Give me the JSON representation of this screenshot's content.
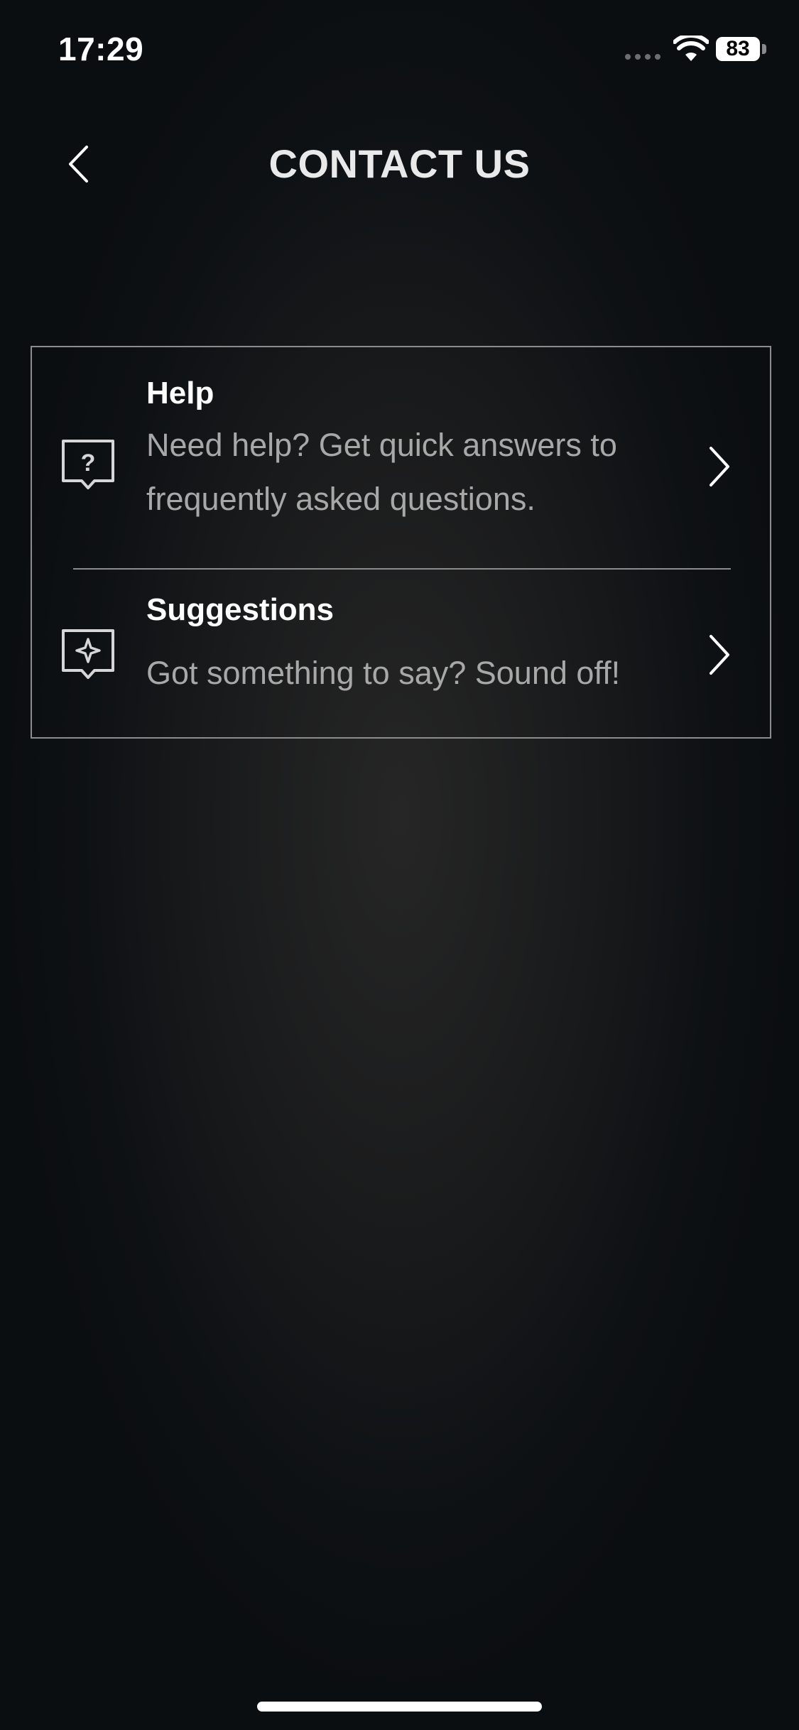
{
  "status_bar": {
    "time": "17:29",
    "battery": "83"
  },
  "header": {
    "title": "CONTACT US"
  },
  "menu": {
    "items": [
      {
        "title": "Help",
        "description": "Need help? Get quick answers to frequently asked questions.",
        "icon": "help-chat-icon"
      },
      {
        "title": "Suggestions",
        "description": "Got something to say? Sound off!",
        "icon": "suggestion-chat-icon"
      }
    ]
  },
  "colors": {
    "background": "#0b0e11",
    "card_border": "#8c8c8c",
    "title_text": "#e9e9e9",
    "description_text": "#a8a8a8"
  }
}
